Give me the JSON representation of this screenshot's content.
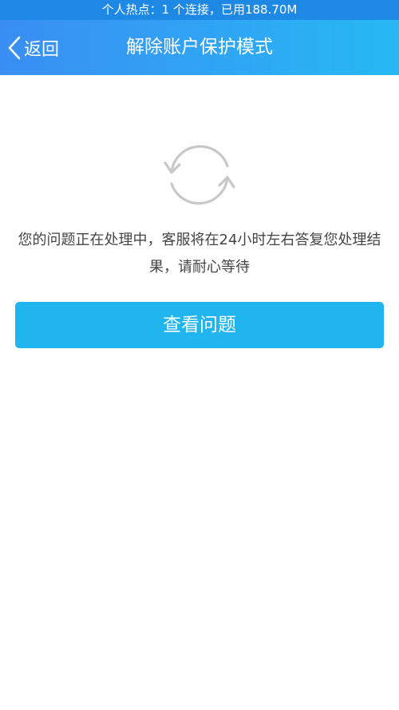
{
  "status_bar": {
    "text": "个人热点：1 个连接，已用188.70M"
  },
  "nav": {
    "back_label": "返回",
    "title": "解除账户保护模式"
  },
  "main": {
    "icon": "refresh-icon",
    "message": "您的问题正在处理中，客服将在24小时左右答复您处理结果，请耐心等待",
    "button_label": "查看问题"
  },
  "colors": {
    "status_bar": "#1e88e5",
    "nav_start": "#3a8ef3",
    "nav_end": "#27b8f4",
    "button": "#21b5ef",
    "icon": "#c8c8c8",
    "text": "#444444"
  }
}
